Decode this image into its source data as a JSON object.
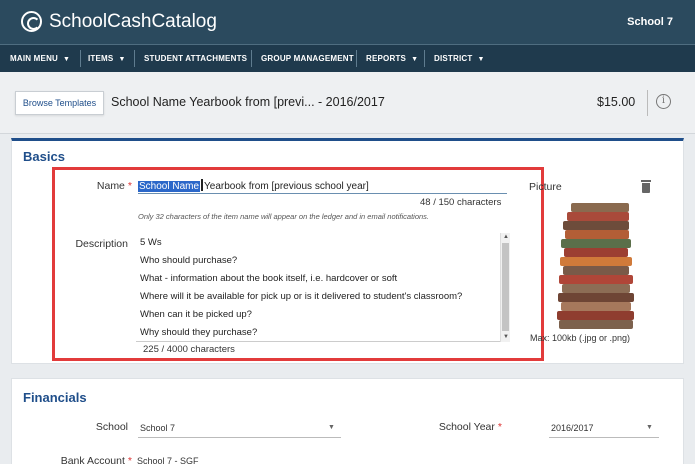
{
  "app": {
    "brand": "SchoolCashCatalog",
    "school": "School 7"
  },
  "nav": [
    {
      "label": "MAIN MENU",
      "caret": true
    },
    {
      "label": "ITEMS",
      "caret": true
    },
    {
      "label": "STUDENT ATTACHMENTS",
      "caret": false
    },
    {
      "label": "GROUP MANAGEMENT",
      "caret": false
    },
    {
      "label": "REPORTS",
      "caret": true
    },
    {
      "label": "DISTRICT",
      "caret": true
    }
  ],
  "titlebar": {
    "browse_label": "Browse Templates",
    "item_title": "School Name Yearbook from [previ...  - 2016/2017",
    "price": "$15.00"
  },
  "basics": {
    "heading": "Basics",
    "name_label": "Name",
    "name_selected": "School Name",
    "name_rest": "Yearbook from [previous school year]",
    "name_count": "48 / 150  characters",
    "name_hint": "Only 32 characters of the item name will appear on the ledger and in email notifications.",
    "description_label": "Description",
    "description_lines": [
      "5 Ws",
      "Who should purchase?",
      "What - information about the book itself, i.e. hardcover or soft",
      "Where will it be available for pick up or is it delivered to student's classroom?",
      "When can it be picked up?",
      "Why should they purchase?"
    ],
    "description_count": "225 / 4000  characters",
    "picture_label": "Picture",
    "picture_max": "Max: 100kb (.jpg or .png)"
  },
  "financials": {
    "heading": "Financials",
    "school_label": "School",
    "school_value": "School 7",
    "school_year_label": "School Year",
    "school_year_value": "2016/2017",
    "bank_account_label": "Bank Account",
    "bank_account_value": "School 7 - SGF"
  },
  "colors": {
    "header": "#2b4a5e",
    "nav": "#1f3a4d",
    "accent": "#1f4e8a",
    "highlight_box": "#e23b3b",
    "required": "#d33"
  }
}
